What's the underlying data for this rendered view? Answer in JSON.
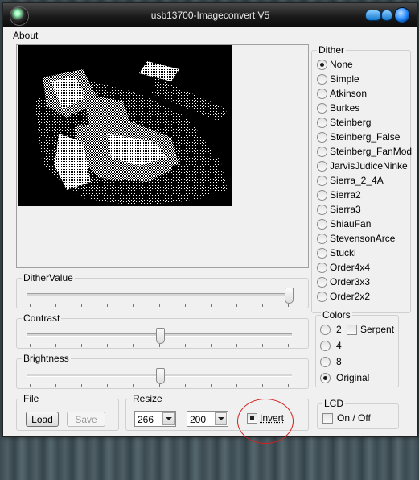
{
  "window": {
    "title": "usb13700-Imageconvert V5"
  },
  "menu": {
    "items": [
      "About"
    ]
  },
  "dither": {
    "legend": "Dither",
    "options": [
      "None",
      "Simple",
      "Atkinson",
      "Burkes",
      "Steinberg",
      "Steinberg_False",
      "Steinberg_FanMod",
      "JarvisJudiceNinke",
      "Sierra_2_4A",
      "Sierra2",
      "Sierra3",
      "ShiauFan",
      "StevensonArce",
      "Stucki",
      "Order4x4",
      "Order3x3",
      "Order2x2"
    ],
    "selected": "None"
  },
  "sliders": {
    "dither_value": {
      "label": "DitherValue",
      "value_fraction": 1.0
    },
    "contrast": {
      "label": "Contrast",
      "value_fraction": 0.5
    },
    "brightness": {
      "label": "Brightness",
      "value_fraction": 0.5
    }
  },
  "colors": {
    "legend": "Colors",
    "options": [
      "2",
      "4",
      "8",
      "Original"
    ],
    "selected": "Original",
    "serpent_label": "Serpent",
    "serpent_checked": false
  },
  "file": {
    "legend": "File",
    "load_label": "Load",
    "save_label": "Save",
    "save_enabled": false
  },
  "resize": {
    "legend": "Resize",
    "width": "266",
    "height": "200",
    "invert_label": "Invert",
    "invert_checked": true
  },
  "lcd": {
    "legend": "LCD",
    "onoff_label": "On / Off",
    "onoff_checked": false
  },
  "annotation": {
    "color": "#d42020"
  }
}
